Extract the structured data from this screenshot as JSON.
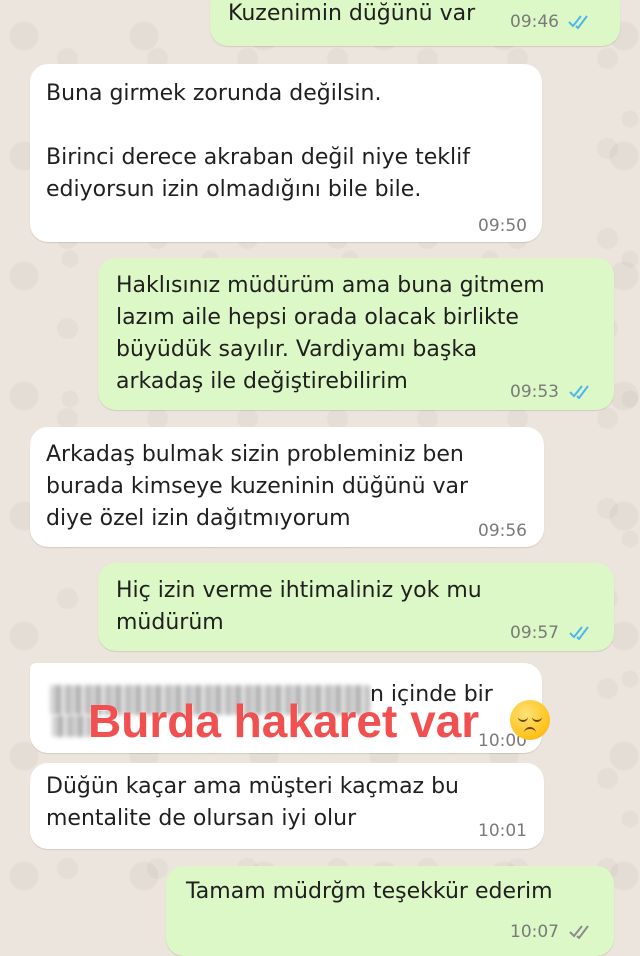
{
  "messages": [
    {
      "id": "m1",
      "dir": "out",
      "lines": [
        "Kuzenimin düğünü var"
      ],
      "time": "09:46",
      "read": true
    },
    {
      "id": "m2",
      "dir": "in",
      "lines": [
        "Buna girmek zorunda değilsin.",
        "",
        "Birinci derece akraban değil niye teklif",
        "ediyorsun izin olmadığını bile bile."
      ],
      "time": "09:50"
    },
    {
      "id": "m3",
      "dir": "out",
      "lines": [
        "Haklısınız müdürüm ama buna gitmem",
        "lazım aile hepsi orada olacak birlikte",
        "büyüdük sayılır. Vardiyamı başka",
        "arkadaş ile değiştirebilirim"
      ],
      "time": "09:53",
      "read": true
    },
    {
      "id": "m4",
      "dir": "in",
      "lines": [
        "Arkadaş bulmak sizin probleminiz ben",
        "burada kimseye kuzeninin düğünü var",
        "diye özel izin dağıtmıyorum"
      ],
      "time": "09:56"
    },
    {
      "id": "m5",
      "dir": "out",
      "lines": [
        "Hiç izin verme ihtimaliniz yok mu",
        "müdürüm"
      ],
      "time": "09:57",
      "read": true
    },
    {
      "id": "m6",
      "dir": "in",
      "visible_text": "n içinde bir",
      "time": "10:00",
      "censored": true
    },
    {
      "id": "m7",
      "dir": "in",
      "lines": [
        "Düğün kaçar ama müşteri kaçmaz bu",
        "mentalite de olursan iyi olur"
      ],
      "time": "10:01"
    },
    {
      "id": "m8",
      "dir": "out",
      "lines": [
        "Tamam müdrğm teşekkür ederim"
      ],
      "time": "10:07",
      "read": false
    }
  ],
  "annotation": {
    "text": "Burda hakaret var",
    "emoji": "pensive-face-emoji"
  },
  "colors": {
    "incoming": "#ffffff",
    "outgoing": "#dcf8c6",
    "read_ticks": "#4fb6ec",
    "unread_ticks": "#8c8c8c",
    "overlay_text": "#f15050"
  }
}
